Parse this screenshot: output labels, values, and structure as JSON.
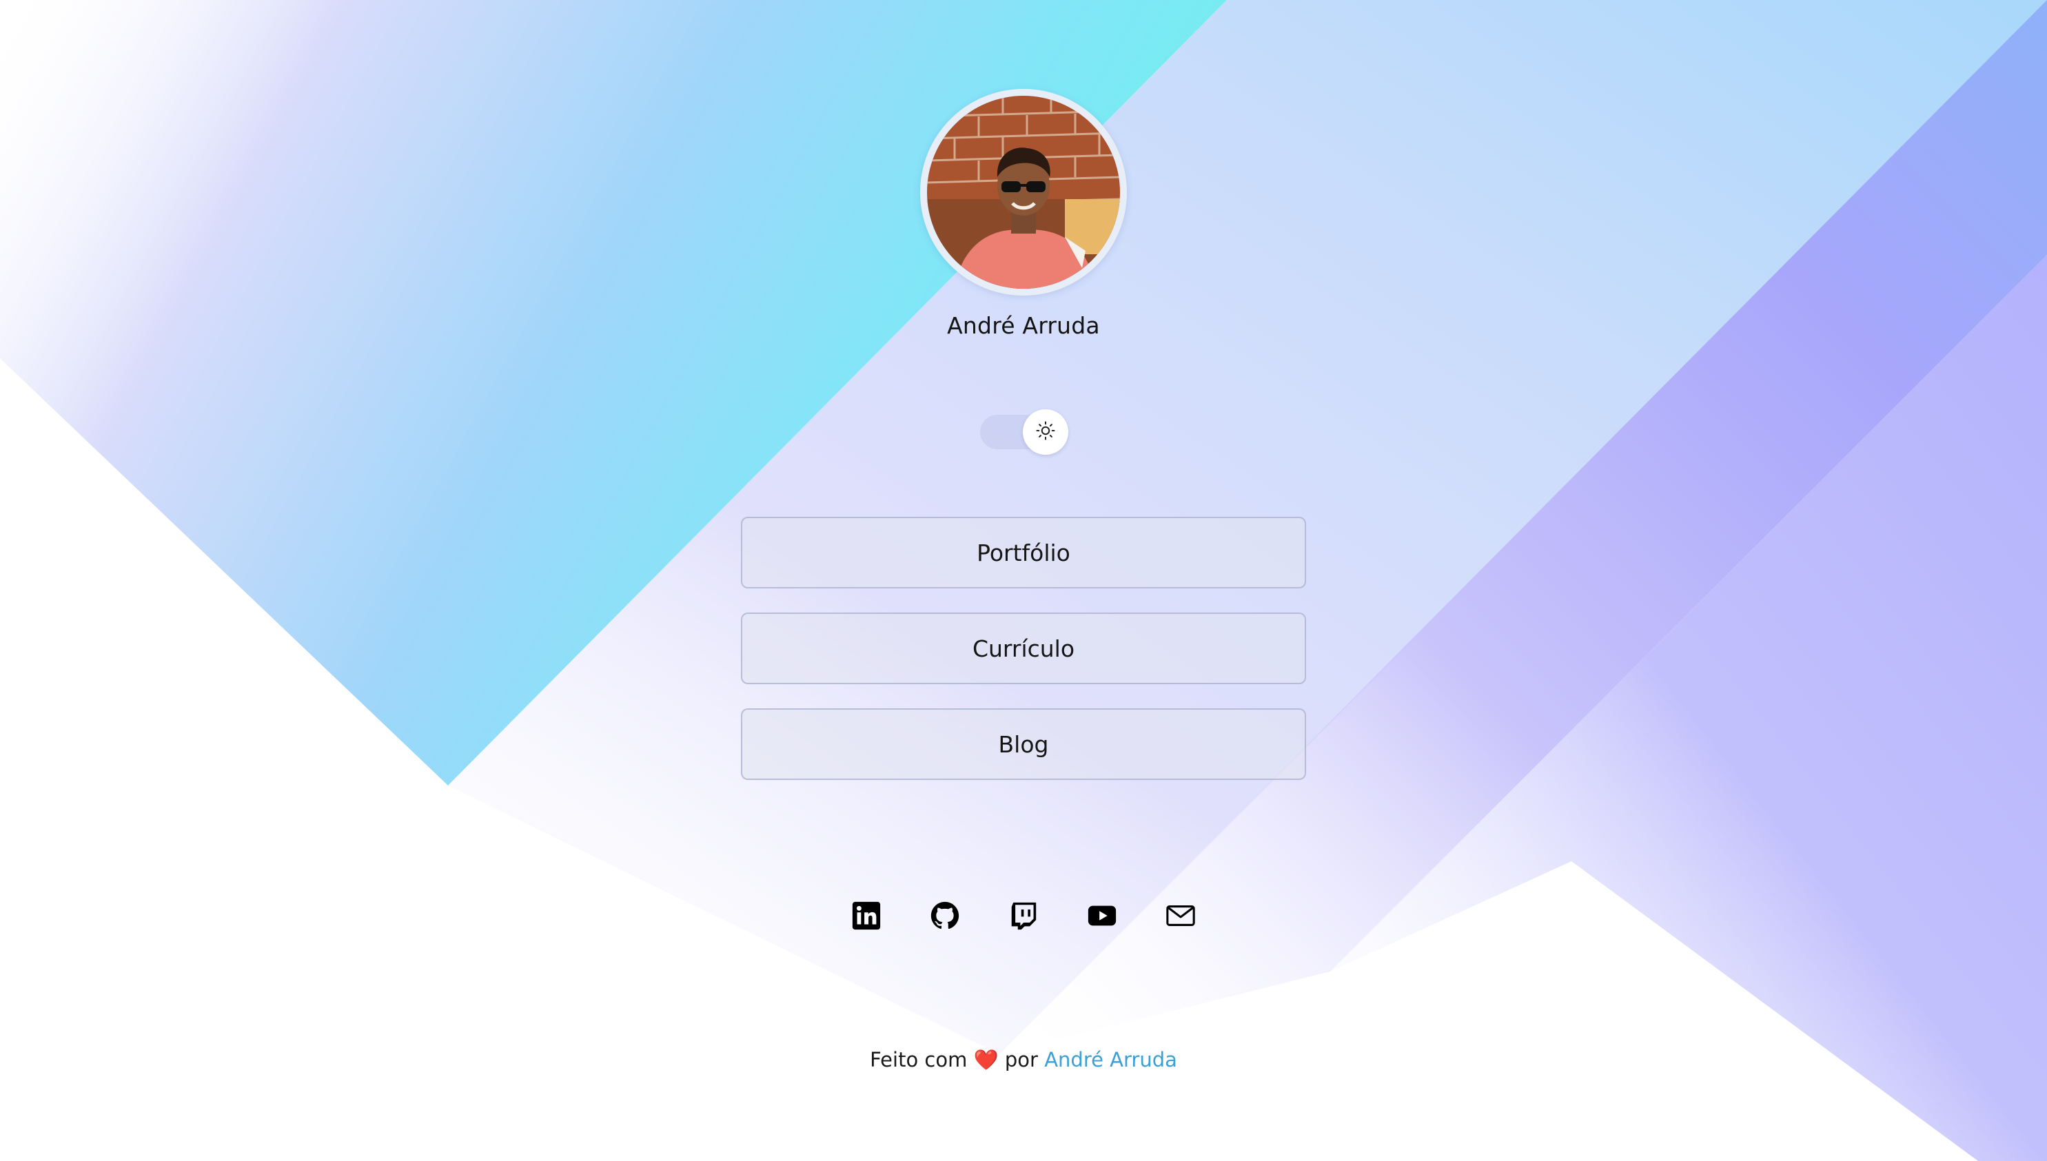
{
  "profile": {
    "name": "André Arruda"
  },
  "theme_toggle": {
    "icon": "sun-icon",
    "state": "light"
  },
  "links": [
    {
      "label": "Portfólio"
    },
    {
      "label": "Currículo"
    },
    {
      "label": "Blog"
    }
  ],
  "socials": [
    {
      "icon": "linkedin-icon"
    },
    {
      "icon": "github-icon"
    },
    {
      "icon": "twitch-icon"
    },
    {
      "icon": "youtube-icon"
    },
    {
      "icon": "mail-icon"
    }
  ],
  "footer": {
    "prefix": "Feito com",
    "heart": "❤️",
    "middle": "por",
    "author": "André Arruda"
  },
  "colors": {
    "link_accent": "#3aa0d6",
    "gradient_cyan": "#8ff3f7",
    "gradient_blue": "#8fc9f7",
    "gradient_violet": "#a9a3fb"
  }
}
